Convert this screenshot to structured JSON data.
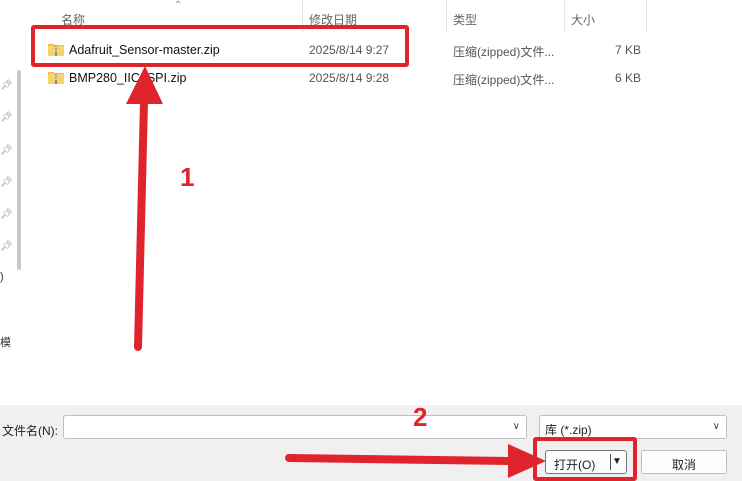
{
  "columns": {
    "name": "名称",
    "date": "修改日期",
    "type": "类型",
    "size": "大小"
  },
  "files": [
    {
      "name": "Adafruit_Sensor-master.zip",
      "date": "2025/8/14 9:27",
      "type": "压缩(zipped)文件...",
      "size": "7 KB",
      "icon": "zip-folder-icon"
    },
    {
      "name": "BMP280_IIC_SPI.zip",
      "date": "2025/8/14 9:28",
      "type": "压缩(zipped)文件...",
      "size": "6 KB",
      "icon": "zip-folder-icon"
    }
  ],
  "nav": {
    "fragments": [
      ")",
      "模"
    ]
  },
  "footer": {
    "filename_label": "文件名(N):",
    "filename_value": "",
    "filter": "库 (*.zip)",
    "open_label": "打开(O)",
    "cancel_label": "取消"
  },
  "annotations": {
    "step1": "1",
    "step2": "2",
    "color": "#e0242c"
  }
}
